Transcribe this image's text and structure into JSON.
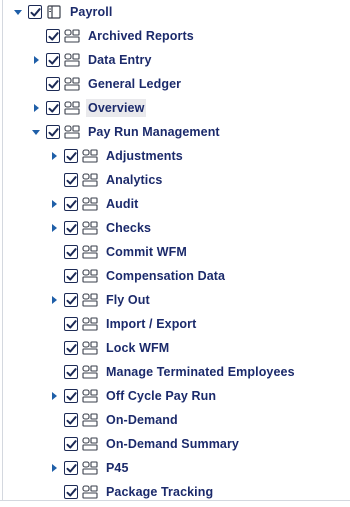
{
  "tree": {
    "root": {
      "label": "Payroll",
      "expanded": true,
      "checked": true
    },
    "items": [
      {
        "label": "Archived Reports",
        "level": 1,
        "toggle": "none",
        "checked": true
      },
      {
        "label": "Data Entry",
        "level": 1,
        "toggle": "collapsed",
        "checked": true
      },
      {
        "label": "General Ledger",
        "level": 1,
        "toggle": "none",
        "checked": true
      },
      {
        "label": "Overview",
        "level": 1,
        "toggle": "collapsed",
        "checked": true,
        "highlighted": true
      },
      {
        "label": "Pay Run Management",
        "level": 1,
        "toggle": "expanded",
        "checked": true
      },
      {
        "label": "Adjustments",
        "level": 2,
        "toggle": "collapsed",
        "checked": true
      },
      {
        "label": "Analytics",
        "level": 2,
        "toggle": "none",
        "checked": true
      },
      {
        "label": "Audit",
        "level": 2,
        "toggle": "collapsed",
        "checked": true
      },
      {
        "label": "Checks",
        "level": 2,
        "toggle": "collapsed",
        "checked": true
      },
      {
        "label": "Commit WFM",
        "level": 2,
        "toggle": "none",
        "checked": true
      },
      {
        "label": "Compensation Data",
        "level": 2,
        "toggle": "none",
        "checked": true
      },
      {
        "label": "Fly Out",
        "level": 2,
        "toggle": "collapsed",
        "checked": true
      },
      {
        "label": "Import / Export",
        "level": 2,
        "toggle": "none",
        "checked": true
      },
      {
        "label": "Lock WFM",
        "level": 2,
        "toggle": "none",
        "checked": true
      },
      {
        "label": "Manage Terminated Employees",
        "level": 2,
        "toggle": "none",
        "checked": true
      },
      {
        "label": "Off Cycle Pay Run",
        "level": 2,
        "toggle": "collapsed",
        "checked": true
      },
      {
        "label": "On-Demand",
        "level": 2,
        "toggle": "none",
        "checked": true
      },
      {
        "label": "On-Demand Summary",
        "level": 2,
        "toggle": "none",
        "checked": true
      },
      {
        "label": "P45",
        "level": 2,
        "toggle": "collapsed",
        "checked": true
      },
      {
        "label": "Package Tracking",
        "level": 2,
        "toggle": "none",
        "checked": true
      }
    ]
  },
  "colors": {
    "label": "#1b2a6b",
    "toggle": "#1f5fa8",
    "checkbox": "#1c2a55",
    "highlight": "#e9e9ec"
  },
  "icons": {
    "root": "module-icon",
    "item": "page-group-icon",
    "collapsed": "caret-right-icon",
    "expanded": "caret-down-icon",
    "checked": "checkmark-icon"
  }
}
